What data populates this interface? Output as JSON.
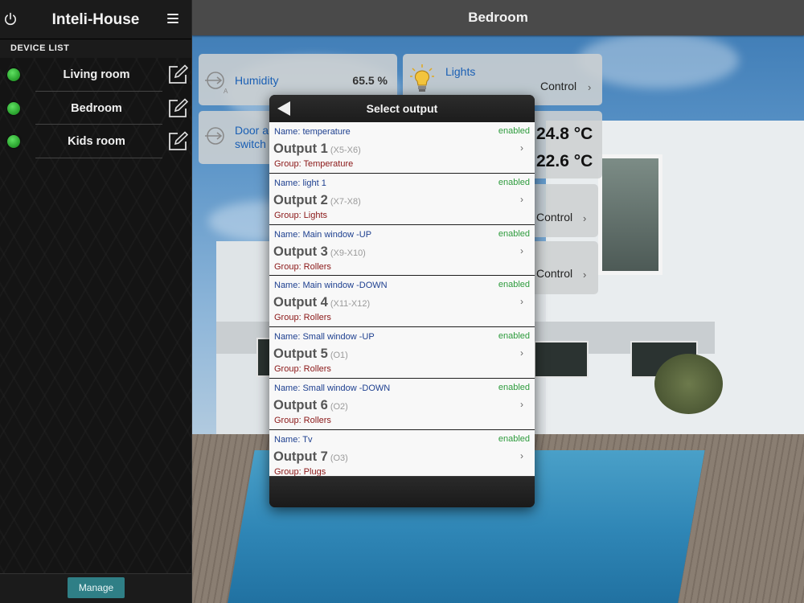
{
  "sidebar": {
    "app_title": "Inteli-House",
    "section_label": "DEVICE LIST",
    "devices": [
      {
        "name": "Living room",
        "status_color": "#2ea832"
      },
      {
        "name": "Bedroom",
        "status_color": "#2ea832"
      },
      {
        "name": "Kids room",
        "status_color": "#2ea832"
      }
    ],
    "manage_label": "Manage"
  },
  "main": {
    "title": "Bedroom",
    "tiles": {
      "humidity": {
        "label": "Humidity",
        "value": "65.5 %"
      },
      "lights": {
        "label": "Lights",
        "control": "Control"
      },
      "door": {
        "label_line1": "Door al",
        "label_line2": "switch"
      },
      "temp1": "24.8 °C",
      "temp2": "22.6 °C",
      "control_a": "Control",
      "control_b": "Control"
    }
  },
  "dialog": {
    "title": "Select output",
    "items": [
      {
        "name": "Name: temperature",
        "status": "enabled",
        "output": "Output 1",
        "pins": "(X5-X6)",
        "group": "Group: Temperature"
      },
      {
        "name": "Name: light 1",
        "status": "enabled",
        "output": "Output 2",
        "pins": "(X7-X8)",
        "group": "Group: Lights"
      },
      {
        "name": "Name: Main window -UP",
        "status": "enabled",
        "output": "Output 3",
        "pins": "(X9-X10)",
        "group": "Group: Rollers"
      },
      {
        "name": "Name: Main window -DOWN",
        "status": "enabled",
        "output": "Output 4",
        "pins": "(X11-X12)",
        "group": "Group: Rollers"
      },
      {
        "name": "Name: Small window -UP",
        "status": "enabled",
        "output": "Output 5",
        "pins": "(O1)",
        "group": "Group: Rollers"
      },
      {
        "name": "Name: Small window -DOWN",
        "status": "enabled",
        "output": "Output 6",
        "pins": "(O2)",
        "group": "Group: Rollers"
      },
      {
        "name": "Name: Tv",
        "status": "enabled",
        "output": "Output 7",
        "pins": "(O3)",
        "group": "Group: Plugs"
      }
    ]
  },
  "icons": {
    "power": "power-icon",
    "menu": "hamburger-menu-icon",
    "edit": "edit-pencil-icon",
    "sensor": "sensor-icon",
    "bulb": "light-bulb-icon",
    "back": "back-arrow-icon",
    "chevron": "chevron-right-icon"
  },
  "colors": {
    "enabled": "#2e9b3d",
    "name": "#1d3f8f",
    "group": "#8a1717",
    "accent": "#2f7f86",
    "tile_label": "#1a5fb4"
  }
}
